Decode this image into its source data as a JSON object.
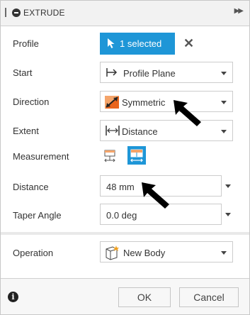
{
  "header": {
    "title": "EXTRUDE"
  },
  "rows": {
    "profile": {
      "label": "Profile",
      "selection": "1 selected"
    },
    "start": {
      "label": "Start",
      "value": "Profile Plane"
    },
    "direction": {
      "label": "Direction",
      "value": "Symmetric"
    },
    "extent": {
      "label": "Extent",
      "value": "Distance"
    },
    "measurement": {
      "label": "Measurement"
    },
    "distance": {
      "label": "Distance",
      "value": "48 mm"
    },
    "taper": {
      "label": "Taper Angle",
      "value": "0.0 deg"
    },
    "operation": {
      "label": "Operation",
      "value": "New Body"
    }
  },
  "footer": {
    "ok_label": "OK",
    "cancel_label": "Cancel"
  },
  "colors": {
    "accent": "#1e96d7",
    "text": "#333333",
    "border": "#cccccc"
  },
  "icons": [
    "grip-icon",
    "extrude-icon",
    "expand-icon",
    "cursor-icon",
    "clear-icon",
    "start-icon",
    "symmetric-icon",
    "distance-icon",
    "measure-one-side-icon",
    "measure-symmetric-icon",
    "new-body-icon",
    "info-icon",
    "pointer-arrow-icon"
  ]
}
